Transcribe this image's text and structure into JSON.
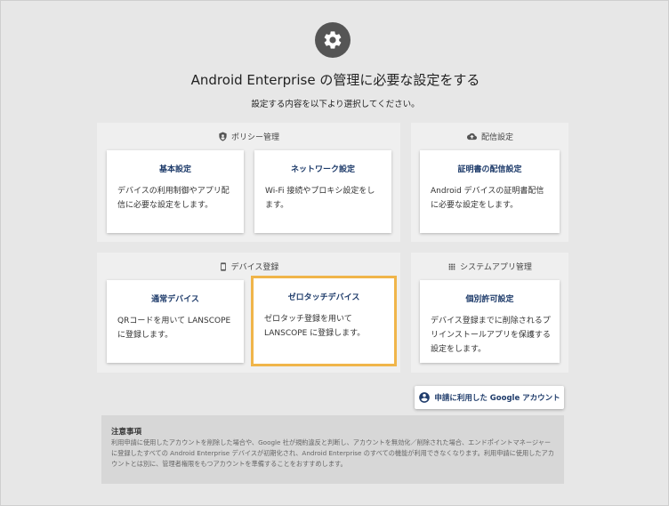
{
  "header": {
    "icon": "gear-icon",
    "title": "Android Enterprise の管理に必要な設定をする",
    "subtitle": "設定する内容を以下より選択してください。"
  },
  "groups": {
    "policy": {
      "icon": "shield-icon",
      "title": "ポリシー管理",
      "cards": [
        {
          "title": "基本設定",
          "desc": "デバイスの利用制御やアプリ配信に必要な設定をします。"
        },
        {
          "title": "ネットワーク設定",
          "desc": "Wi-Fi 接続やプロキシ設定をします。"
        }
      ]
    },
    "distribution": {
      "icon": "cloud-upload-icon",
      "title": "配信設定",
      "cards": [
        {
          "title": "証明書の配信設定",
          "desc": "Android デバイスの証明書配信に必要な設定をします。"
        }
      ]
    },
    "device": {
      "icon": "phone-icon",
      "title": "デバイス登録",
      "cards": [
        {
          "title": "通常デバイス",
          "desc": "QRコードを用いて LANSCOPE に登録します。"
        },
        {
          "title": "ゼロタッチデバイス",
          "desc": "ゼロタッチ登録を用いて LANSCOPE に登録します。"
        }
      ]
    },
    "system_app": {
      "icon": "grid-icon",
      "title": "システムアプリ管理",
      "cards": [
        {
          "title": "個別許可設定",
          "desc": "デバイス登録までに削除されるプリインストールアプリを保護する設定をします。"
        }
      ]
    }
  },
  "account_button": {
    "icon": "account-circle-icon",
    "label": "申請に利用した Google アカウント"
  },
  "notice": {
    "title": "注意事項",
    "body": "利用申請に使用したアカウントを削除した場合や、Google 社が規約違反と判断し、アカウントを無効化／削除された場合、エンドポイントマネージャーに登録したすべての Android Enterprise デバイスが初期化され、Android Enterprise のすべての機能が利用できなくなります。利用申請に使用したアカウントとは別に、管理者権限をもつアカウントを準備することをおすすめします。"
  },
  "colors": {
    "accent": "#1f3c6b",
    "selected_outline": "#f0b54a",
    "background": "#e7e7e7"
  }
}
